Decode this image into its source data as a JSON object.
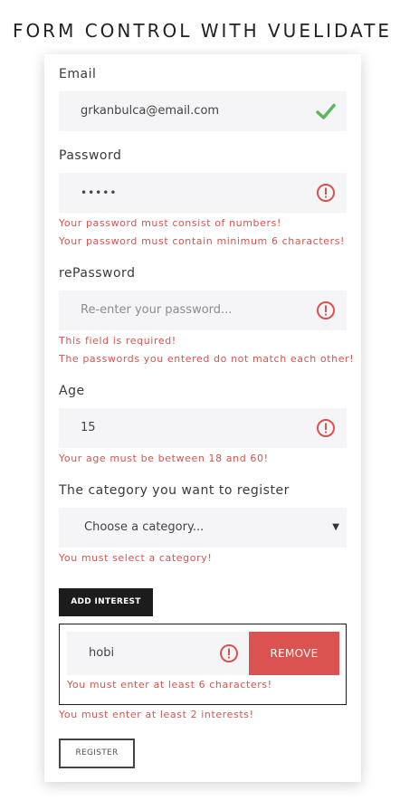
{
  "page": {
    "title": "FORM CONTROL WITH VUELIDATE"
  },
  "colors": {
    "error": "#d9534f",
    "success": "#5cb85c",
    "remove_button": "#db5350",
    "add_button": "#1c1c1c"
  },
  "email": {
    "label": "Email",
    "value": "grkanbulca@email.com",
    "status_icon": "check-icon"
  },
  "password": {
    "label": "Password",
    "value": "•••••",
    "status_icon": "error-icon",
    "errors": [
      "Your password must consist of numbers!",
      "Your password must contain minimum 6 characters!"
    ]
  },
  "repassword": {
    "label": "rePassword",
    "placeholder": "Re-enter your password...",
    "status_icon": "error-icon",
    "errors": [
      "This field is required!",
      "The passwords you entered do not match each other!"
    ]
  },
  "age": {
    "label": "Age",
    "value": "15",
    "status_icon": "error-icon",
    "errors": [
      "Your age must be between 18 and 60!"
    ]
  },
  "category": {
    "label": "The category you want to register",
    "selected": "Choose a category...",
    "arrow_icon": "caret-down-icon",
    "errors": [
      "You must select a category!"
    ]
  },
  "interests": {
    "add_label": "ADD INTEREST",
    "items": [
      {
        "value": "hobi",
        "status_icon": "error-icon",
        "remove_label": "REMOVE",
        "error": "You must enter at least 6 characters!"
      }
    ],
    "error": "You must enter at least 2 interests!"
  },
  "register": {
    "label": "REGISTER"
  }
}
